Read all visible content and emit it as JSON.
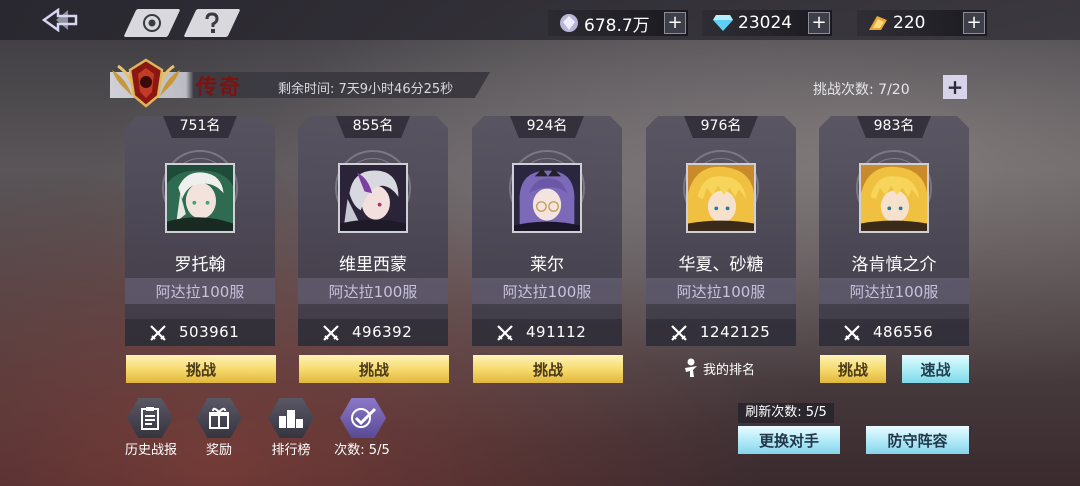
{
  "currencies": [
    {
      "icon": "silver-gem-icon",
      "value": "678.7万"
    },
    {
      "icon": "blue-diamond-icon",
      "value": "23024"
    },
    {
      "icon": "gold-ticket-icon",
      "value": "220"
    }
  ],
  "header": {
    "title": "传奇",
    "remaining_time": "剩余时间: 7天9小时46分25秒",
    "challenge_count": "挑战次数: 7/20"
  },
  "opponents": [
    {
      "rank": "751名",
      "name": "罗托翰",
      "server": "阿达拉100服",
      "power": "503961",
      "action": "挑战"
    },
    {
      "rank": "855名",
      "name": "维里西蒙",
      "server": "阿达拉100服",
      "power": "496392",
      "action": "挑战"
    },
    {
      "rank": "924名",
      "name": "莱尔",
      "server": "阿达拉100服",
      "power": "491112",
      "action": "挑战"
    },
    {
      "rank": "976名",
      "name": "华夏、砂糖",
      "server": "阿达拉100服",
      "power": "1242125",
      "action": "我的排名"
    },
    {
      "rank": "983名",
      "name": "洛肯慎之介",
      "server": "阿达拉100服",
      "power": "486556",
      "action": "挑战",
      "action2": "速战"
    }
  ],
  "bottom": {
    "history": "历史战报",
    "reward": "奖励",
    "leaderboard": "排行榜",
    "times": "次数: 5/5",
    "refresh_count": "刷新次数: 5/5",
    "change_opponent": "更换对手",
    "defense_lineup": "防守阵容"
  },
  "colors": {
    "title": "#7a1412",
    "challenge_button": "#f5d868",
    "quick_button": "#a8ecf5"
  }
}
